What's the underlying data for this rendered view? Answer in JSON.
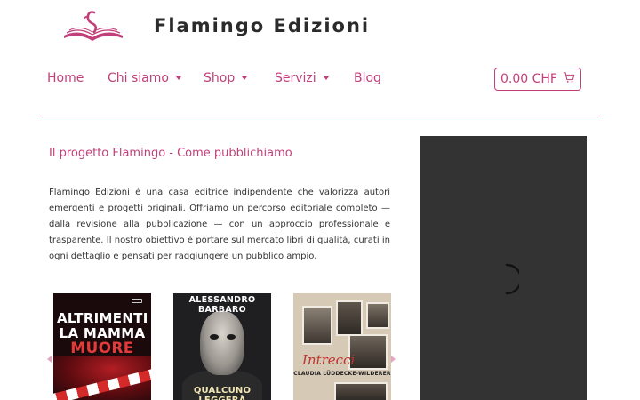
{
  "header": {
    "brand": "Flamingo Edizioni",
    "logo_icon": "flamingo-book-icon",
    "accent_color": "#c2407a"
  },
  "nav": {
    "items": [
      {
        "label": "Home",
        "has_dropdown": false
      },
      {
        "label": "Chi siamo",
        "has_dropdown": true
      },
      {
        "label": "Shop",
        "has_dropdown": true
      },
      {
        "label": "Servizi",
        "has_dropdown": true
      },
      {
        "label": "Blog",
        "has_dropdown": false
      }
    ]
  },
  "cart": {
    "label": "0.00 CHF",
    "icon": "cart-icon"
  },
  "main": {
    "heading": "Il progetto Flamingo - Come pubblichiamo",
    "paragraph": "Flamingo Edizioni è una casa editrice indipendente che valorizza autori emergenti e progetti originali. Offriamo un percorso editoriale completo — dalla revisione alla pubblicazione — con un approccio professionale e trasparente. Il nostro obiettivo è portare sul mercato libri di qualità, curati in ogni dettaglio e pensati per raggiungere un pubblico ampio."
  },
  "carousel": {
    "books": [
      {
        "title_lines": [
          "ALTRIMENTI",
          "LA MAMMA",
          "MUORE"
        ]
      },
      {
        "author": "ALESSANDRO BARBARO",
        "title": "QUALCUNO LEGGERÀ"
      },
      {
        "title": "Intrecci",
        "author": "CLAUDIA LÜDDECKE-WILDERER"
      }
    ]
  },
  "side_panel": {
    "background": "#333333",
    "spinner_icon": "loading-spinner-icon"
  }
}
